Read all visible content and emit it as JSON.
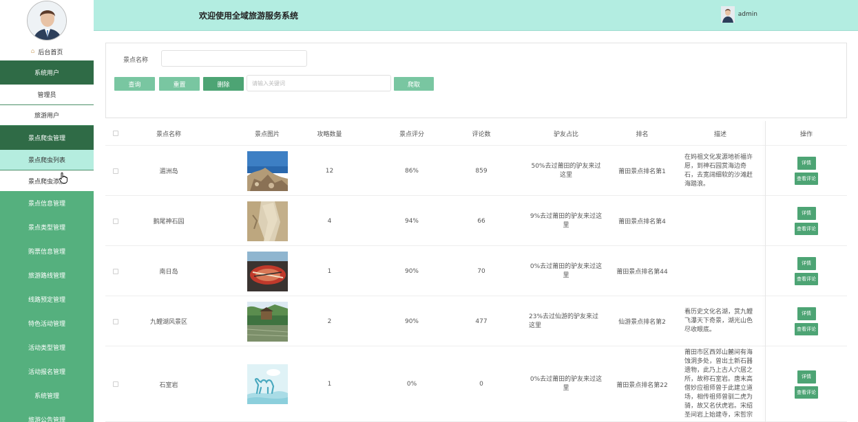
{
  "header": {
    "title": "欢迎使用全域旅游服务系统",
    "username": "admin"
  },
  "sidebar": {
    "home_label": "后台首页",
    "items": [
      {
        "label": "系统用户",
        "kind": "group"
      },
      {
        "label": "管理员",
        "kind": "sub"
      },
      {
        "label": "旅游用户",
        "kind": "sub"
      },
      {
        "label": "景点爬虫管理",
        "kind": "group"
      },
      {
        "label": "景点爬虫列表",
        "kind": "sub",
        "active": true
      },
      {
        "label": "景点爬虫添加",
        "kind": "sub"
      },
      {
        "label": "景点信息管理",
        "kind": "group"
      },
      {
        "label": "景点类型管理",
        "kind": "group"
      },
      {
        "label": "购票信息管理",
        "kind": "group"
      },
      {
        "label": "旅游路线管理",
        "kind": "group"
      },
      {
        "label": "线路预定管理",
        "kind": "group"
      },
      {
        "label": "特色活动管理",
        "kind": "group"
      },
      {
        "label": "活动类型管理",
        "kind": "group"
      },
      {
        "label": "活动报名管理",
        "kind": "group"
      },
      {
        "label": "系统管理",
        "kind": "group"
      },
      {
        "label": "旅游公告管理",
        "kind": "group"
      }
    ]
  },
  "search": {
    "field_label": "景点名称",
    "field_value": "",
    "query_button": "查询",
    "reset_button": "重置",
    "delete_button": "删除",
    "keyword_placeholder": "请输入关键词",
    "crawl_button": "爬取"
  },
  "table": {
    "columns": [
      "景点名称",
      "景点图片",
      "攻略数量",
      "景点评分",
      "评论数",
      "驴友占比",
      "排名",
      "描述",
      "操作"
    ],
    "detail_label": "详情",
    "review_label": "查看评论",
    "rows": [
      {
        "name": "湄洲岛",
        "image": "coast-rocks",
        "guides": "12",
        "score": "86%",
        "comments": "859",
        "ratio": "50%去过莆田的驴友来过这里",
        "rank": "莆田景点排名第1",
        "desc": "在妈祖文化发源地祈福许愿，到神石园赏海边奇石，去宽阔细软的沙滩赶海踏浪。"
      },
      {
        "name": "鹅尾神石园",
        "image": "stone-cliff",
        "guides": "4",
        "score": "94%",
        "comments": "66",
        "ratio": "9%去过莆田的驴友来过这里",
        "rank": "莆田景点排名第4",
        "desc": ""
      },
      {
        "name": "南日岛",
        "image": "boat",
        "guides": "1",
        "score": "90%",
        "comments": "70",
        "ratio": "0%去过莆田的驴友来过这里",
        "rank": "莆田景点排名第44",
        "desc": ""
      },
      {
        "name": "九鲤湖风景区",
        "image": "lake-pavilion",
        "guides": "2",
        "score": "90%",
        "comments": "477",
        "ratio": "23%去过仙游的驴友来过这里",
        "rank": "仙游景点排名第2",
        "desc": "看历史文化名湖，赏九鲤飞瀑天下奇景，湖光山色尽收眼底。"
      },
      {
        "name": "石室岩",
        "image": "camel-illustration",
        "guides": "1",
        "score": "0%",
        "comments": "0",
        "ratio": "0%去过莆田的驴友来过这里",
        "rank": "莆田景点排名第22",
        "desc": "莆田市区西郊山麓间有海蚀洞多处，曾出土新石器遗物，此乃上古人穴居之所，故称石室岩。唐末高僧妙应祖师曾于此建立道场，相传祖师曾驯二虎为骑，故又名伏虎岩。宋绍圣间岩上始建寺，宋哲宗赐额曰'伏虎'"
      }
    ]
  }
}
